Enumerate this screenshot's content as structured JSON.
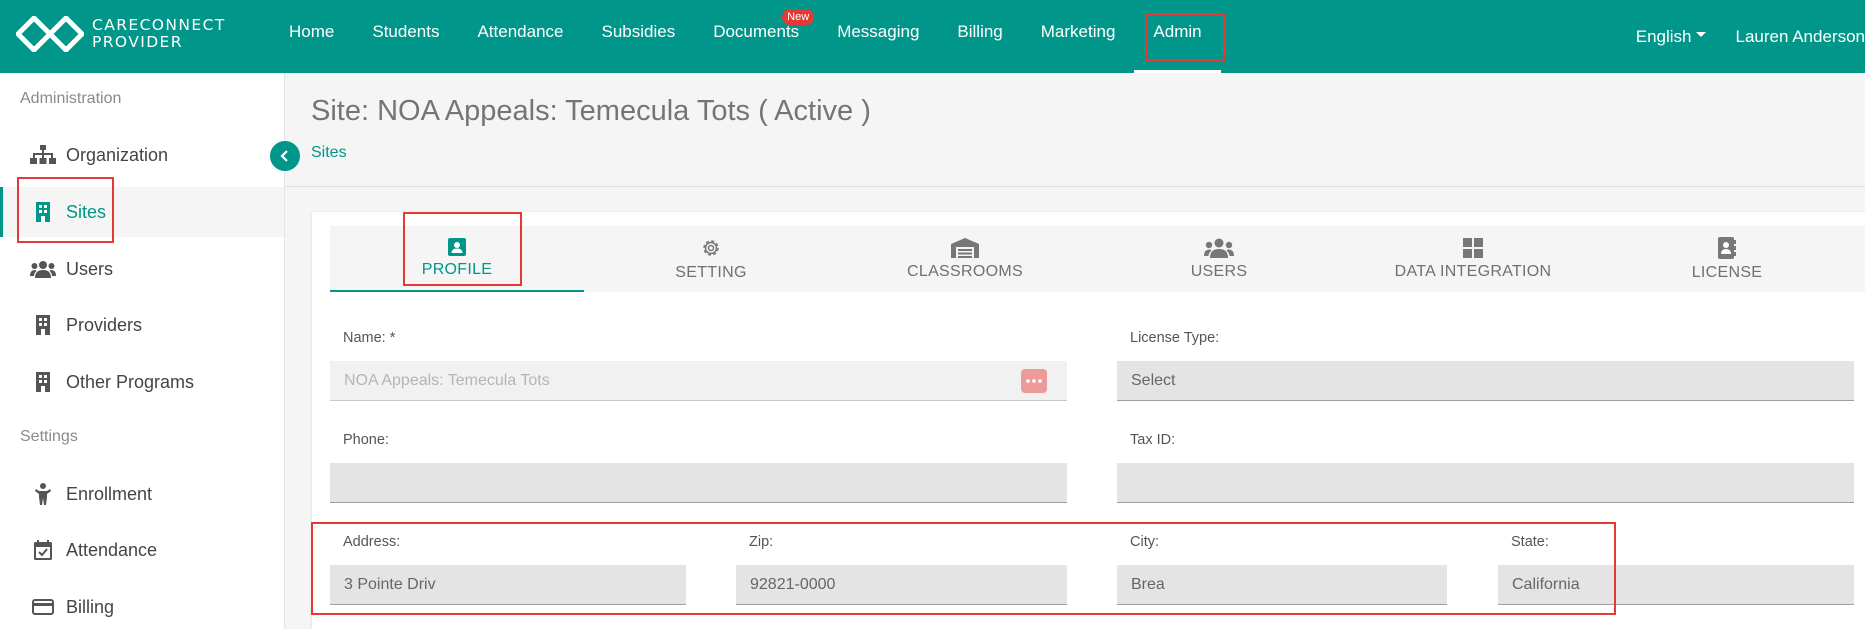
{
  "app": {
    "logo_line1": "CARECONNECT",
    "logo_line2": "PROVIDER",
    "brand_color": "#00968a",
    "highlight_color": "#e53935"
  },
  "nav": {
    "items": [
      {
        "label": "Home"
      },
      {
        "label": "Students"
      },
      {
        "label": "Attendance"
      },
      {
        "label": "Subsidies"
      },
      {
        "label": "Documents",
        "badge": "New"
      },
      {
        "label": "Messaging"
      },
      {
        "label": "Billing"
      },
      {
        "label": "Marketing"
      },
      {
        "label": "Admin",
        "active": true
      }
    ],
    "language": "English",
    "user": "Lauren Anderson"
  },
  "sidebar": {
    "section1": "Administration",
    "section2": "Settings",
    "items": [
      {
        "label": "Organization",
        "icon": "sitemap-icon"
      },
      {
        "label": "Sites",
        "icon": "building-icon",
        "active": true
      },
      {
        "label": "Users",
        "icon": "users-icon"
      },
      {
        "label": "Providers",
        "icon": "building-icon"
      },
      {
        "label": "Other Programs",
        "icon": "building-icon"
      },
      {
        "label": "Enrollment",
        "icon": "child-icon"
      },
      {
        "label": "Attendance",
        "icon": "calendar-check-icon"
      },
      {
        "label": "Billing",
        "icon": "credit-card-icon"
      }
    ]
  },
  "page": {
    "title": "Site: NOA Appeals: Temecula Tots ( Active )",
    "breadcrumb": "Sites"
  },
  "tabs": [
    {
      "label": "PROFILE",
      "icon": "id-badge-icon",
      "active": true
    },
    {
      "label": "SETTING",
      "icon": "gear-icon"
    },
    {
      "label": "CLASSROOMS",
      "icon": "warehouse-icon"
    },
    {
      "label": "USERS",
      "icon": "users-icon"
    },
    {
      "label": "DATA INTEGRATION",
      "icon": "windows-icon"
    },
    {
      "label": "LICENSE",
      "icon": "contact-book-icon"
    }
  ],
  "form": {
    "name_label": "Name: *",
    "name_value": "NOA Appeals: Temecula Tots",
    "license_type_label": "License Type:",
    "license_type_value": "Select",
    "phone_label": "Phone:",
    "phone_value": "",
    "tax_id_label": "Tax ID:",
    "tax_id_value": "",
    "address_label": "Address:",
    "address_value": "3 Pointe Driv",
    "zip_label": "Zip:",
    "zip_value": "92821-0000",
    "city_label": "City:",
    "city_value": "Brea",
    "state_label": "State:",
    "state_value": "California"
  }
}
